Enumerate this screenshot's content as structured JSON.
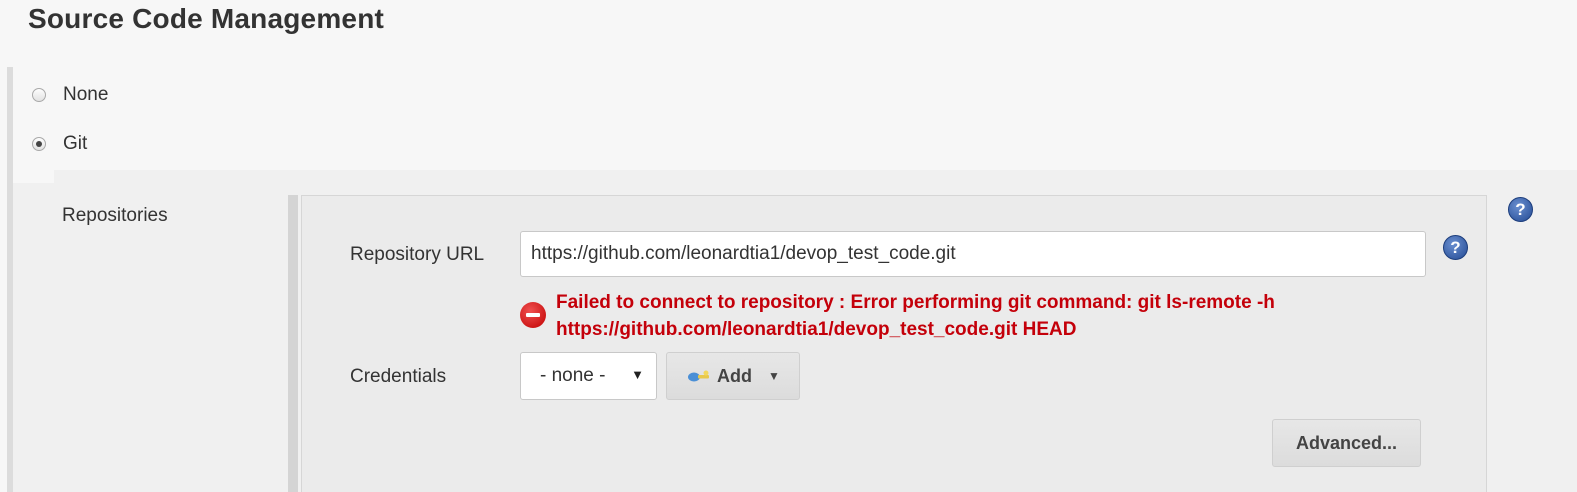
{
  "section": {
    "title": "Source Code Management"
  },
  "scm_options": [
    {
      "label": "None",
      "selected": false
    },
    {
      "label": "Git",
      "selected": true
    }
  ],
  "repositories": {
    "label": "Repositories",
    "url_label": "Repository URL",
    "url_value": "https://github.com/leonardtia1/devop_test_code.git",
    "error_line1": "Failed to connect to repository : Error performing git command: git ls-remote -h",
    "error_line2": "https://github.com/leonardtia1/devop_test_code.git HEAD",
    "credentials_label": "Credentials",
    "credentials_selected": "- none -",
    "add_label": "Add",
    "advanced_label": "Advanced..."
  },
  "icons": {
    "help": "help-icon",
    "error": "error-icon",
    "key": "key-icon",
    "help_glyph": "?"
  },
  "colors": {
    "error": "#c4000a",
    "help": "#234a93"
  }
}
